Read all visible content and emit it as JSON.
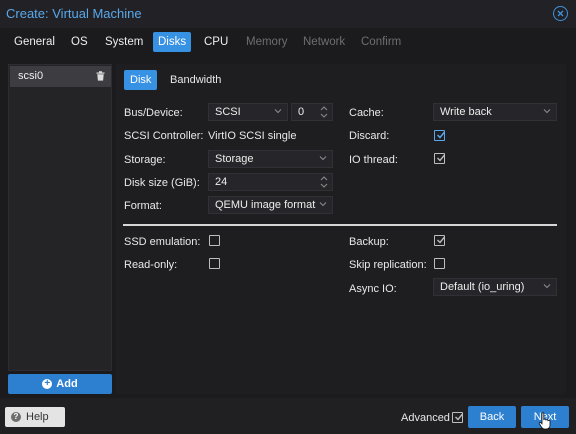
{
  "window": {
    "title": "Create: Virtual Machine"
  },
  "tabs": [
    {
      "label": "General",
      "state": "normal"
    },
    {
      "label": "OS",
      "state": "normal"
    },
    {
      "label": "System",
      "state": "normal"
    },
    {
      "label": "Disks",
      "state": "active"
    },
    {
      "label": "CPU",
      "state": "normal"
    },
    {
      "label": "Memory",
      "state": "disabled"
    },
    {
      "label": "Network",
      "state": "disabled"
    },
    {
      "label": "Confirm",
      "state": "disabled"
    }
  ],
  "disk_list": {
    "items": [
      {
        "label": "scsi0"
      }
    ],
    "add_label": "Add"
  },
  "subtabs": [
    {
      "label": "Disk",
      "state": "active"
    },
    {
      "label": "Bandwidth",
      "state": "normal"
    }
  ],
  "form": {
    "bus_device": {
      "label": "Bus/Device:",
      "bus": "SCSI",
      "device": "0"
    },
    "scsi_controller": {
      "label": "SCSI Controller:",
      "value": "VirtIO SCSI single"
    },
    "storage": {
      "label": "Storage:",
      "value": "Storage"
    },
    "disk_size": {
      "label": "Disk size (GiB):",
      "value": "24"
    },
    "format": {
      "label": "Format:",
      "value": "QEMU image format"
    },
    "cache": {
      "label": "Cache:",
      "value": "Write back"
    },
    "discard": {
      "label": "Discard:",
      "checked": true
    },
    "io_thread": {
      "label": "IO thread:",
      "checked": true
    },
    "ssd_emulation": {
      "label": "SSD emulation:",
      "checked": false
    },
    "read_only": {
      "label": "Read-only:",
      "checked": false
    },
    "backup": {
      "label": "Backup:",
      "checked": true
    },
    "skip_replication": {
      "label": "Skip replication:",
      "checked": false
    },
    "async_io": {
      "label": "Async IO:",
      "value": "Default (io_uring)"
    }
  },
  "footer": {
    "help_label": "Help",
    "advanced_label": "Advanced",
    "advanced_checked": true,
    "back_label": "Back",
    "next_label": "Next"
  },
  "colors": {
    "accent": "#3892e3",
    "title_text": "#5aa8ea",
    "background": "#1b1b1d",
    "checkbox_active": "#5aa8ea"
  }
}
